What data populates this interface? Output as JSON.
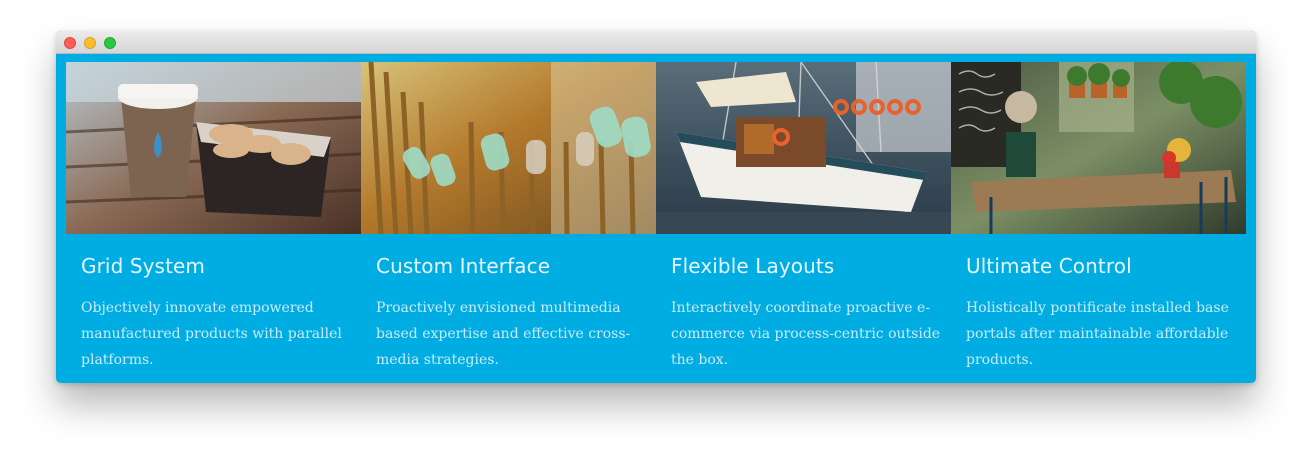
{
  "window": {
    "controls": [
      "close",
      "minimize",
      "zoom"
    ]
  },
  "cards": [
    {
      "image_name": "coffee-macarons-photo",
      "title": "Grid System",
      "text": "Objectively innovate empowered manufactured products with parallel platforms."
    },
    {
      "image_name": "glass-bottles-fence-photo",
      "title": "Custom Interface",
      "text": "Proactively envisioned multimedia based expertise and effective cross-media strategies."
    },
    {
      "image_name": "sailing-boat-harbor-photo",
      "title": "Flexible Layouts",
      "text": "Interactively coordinate proactive e-commerce via process-centric outside the box."
    },
    {
      "image_name": "cafe-terrace-photo",
      "title": "Ultimate Control",
      "text": "Holistically pontificate installed base portals after maintainable affordable products."
    }
  ],
  "colors": {
    "accent": "#00ade2",
    "title_text": "#e6f7ff",
    "body_text": "#c8ecfb"
  }
}
